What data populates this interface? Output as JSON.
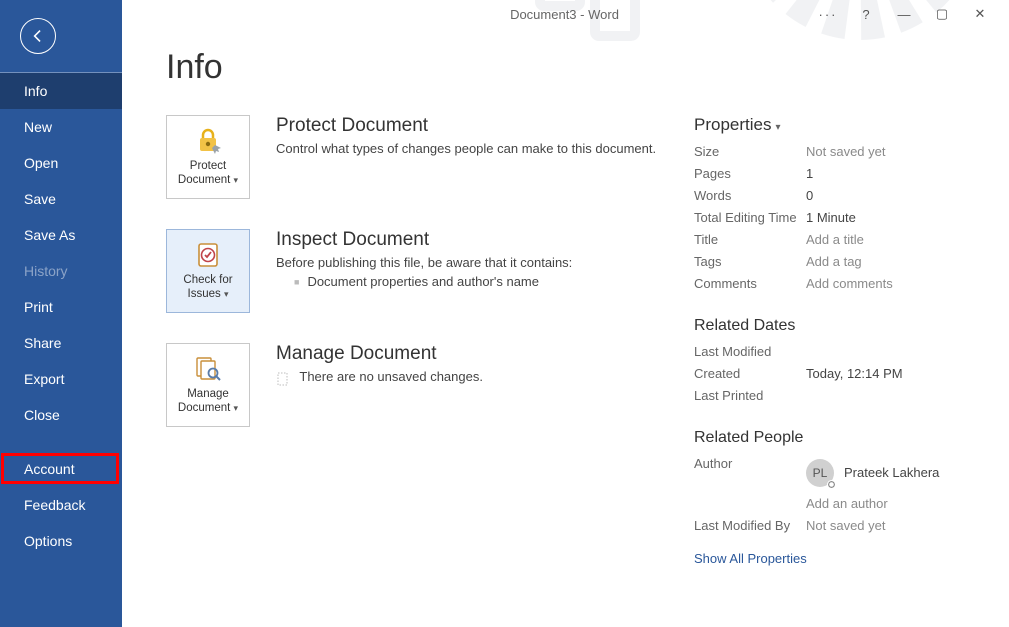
{
  "window": {
    "title": "Document3  -  Word",
    "help": "?",
    "min": "—",
    "restore": "▢",
    "close": "✕"
  },
  "sidebar": {
    "items": [
      {
        "id": "info",
        "label": "Info",
        "selected": true
      },
      {
        "id": "new",
        "label": "New"
      },
      {
        "id": "open",
        "label": "Open"
      },
      {
        "id": "save",
        "label": "Save"
      },
      {
        "id": "saveas",
        "label": "Save As"
      },
      {
        "id": "history",
        "label": "History",
        "disabled": true
      },
      {
        "id": "print",
        "label": "Print"
      },
      {
        "id": "share",
        "label": "Share"
      },
      {
        "id": "export",
        "label": "Export"
      },
      {
        "id": "close",
        "label": "Close"
      }
    ],
    "footer": [
      {
        "id": "account",
        "label": "Account",
        "highlight": true
      },
      {
        "id": "feedback",
        "label": "Feedback"
      },
      {
        "id": "options",
        "label": "Options"
      }
    ]
  },
  "page": {
    "title": "Info"
  },
  "sections": {
    "protect": {
      "tile": "Protect Document",
      "heading": "Protect Document",
      "desc": "Control what types of changes people can make to this document."
    },
    "inspect": {
      "tile": "Check for Issues",
      "heading": "Inspect Document",
      "lead": "Before publishing this file, be aware that it contains:",
      "bullet1": "Document properties and author's name"
    },
    "manage": {
      "tile": "Manage Document",
      "heading": "Manage Document",
      "line": "There are no unsaved changes."
    }
  },
  "props": {
    "heading": "Properties",
    "size_k": "Size",
    "size_v": "Not saved yet",
    "pages_k": "Pages",
    "pages_v": "1",
    "words_k": "Words",
    "words_v": "0",
    "tet_k": "Total Editing Time",
    "tet_v": "1 Minute",
    "title_k": "Title",
    "title_v": "Add a title",
    "tags_k": "Tags",
    "tags_v": "Add a tag",
    "comments_k": "Comments",
    "comments_v": "Add comments",
    "dates_h": "Related Dates",
    "lm_k": "Last Modified",
    "lm_v": "",
    "created_k": "Created",
    "created_v": "Today, 12:14 PM",
    "lp_k": "Last Printed",
    "lp_v": "",
    "people_h": "Related People",
    "author_k": "Author",
    "author_initials": "PL",
    "author_name": "Prateek Lakhera",
    "add_author": "Add an author",
    "lmb_k": "Last Modified By",
    "lmb_v": "Not saved yet",
    "show_all": "Show All Properties"
  }
}
